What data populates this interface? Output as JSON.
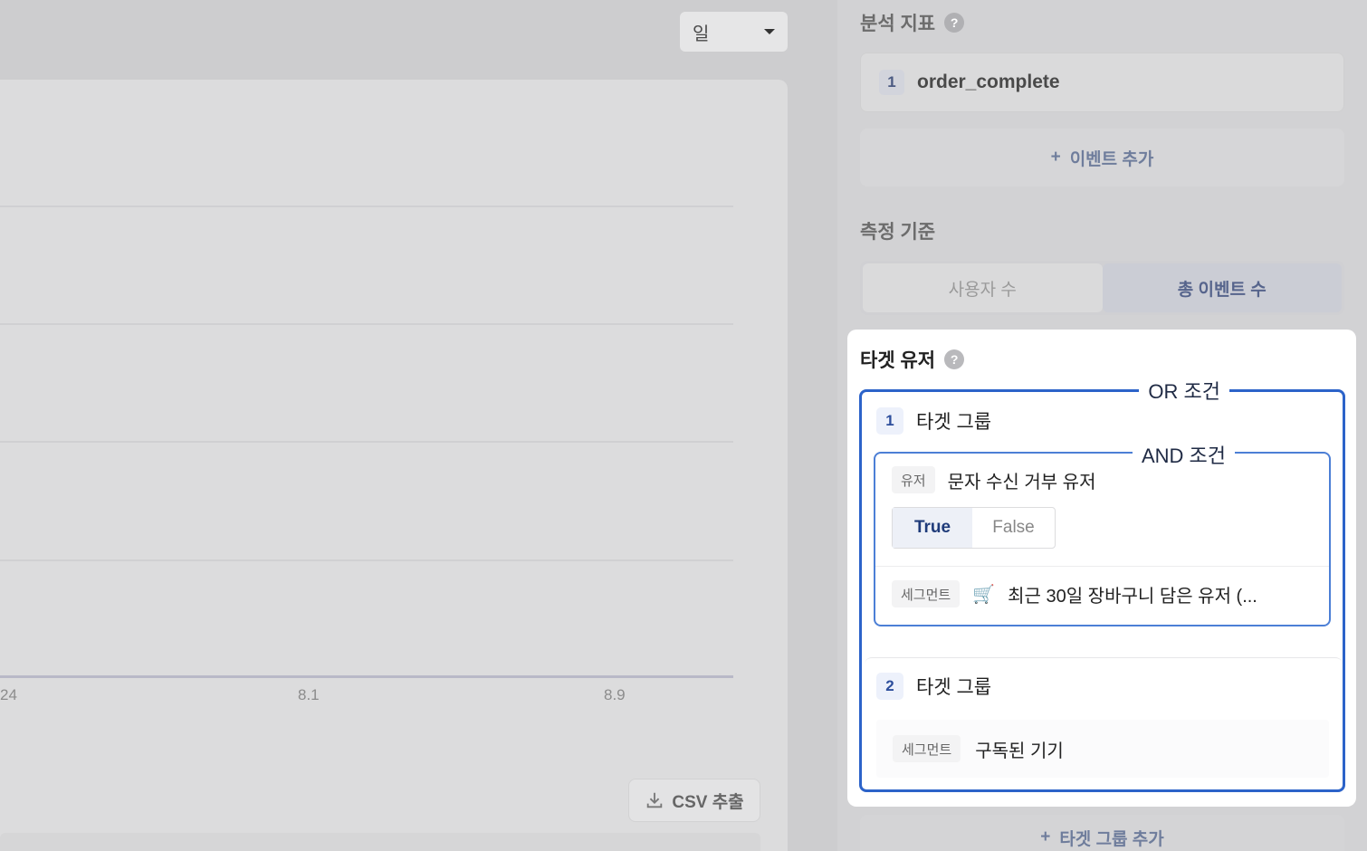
{
  "left": {
    "period_select": "일",
    "x_ticks": [
      "24",
      "8.1",
      "8.9"
    ],
    "csv_label": "CSV 추출"
  },
  "panel": {
    "metric_title": "분석 지표",
    "event": {
      "index": "1",
      "name": "order_complete"
    },
    "add_event_label": "이벤트 추가",
    "measure_title": "측정 기준",
    "measure_options": [
      "사용자 수",
      "총 이벤트 수"
    ],
    "measure_selected": "총 이벤트 수",
    "add_group_label": "타겟 그룹 추가"
  },
  "target": {
    "title": "타겟 유저",
    "or_label": "OR 조건",
    "and_label": "AND 조건",
    "groups": [
      {
        "index": "1",
        "label": "타겟 그룹",
        "conditions": [
          {
            "tag": "유저",
            "text": "문자 수신 거부 유저",
            "options": [
              "True",
              "False"
            ],
            "selected": "True"
          },
          {
            "tag": "세그먼트",
            "text": "최근 30일 장바구니 담은 유저 (..."
          }
        ]
      },
      {
        "index": "2",
        "label": "타겟 그룹",
        "conditions": [
          {
            "tag": "세그먼트",
            "text": "구독된 기기"
          }
        ]
      }
    ]
  },
  "colors": {
    "accent_blue": "#2c63c9",
    "badge_text": "#2d4e9c"
  }
}
